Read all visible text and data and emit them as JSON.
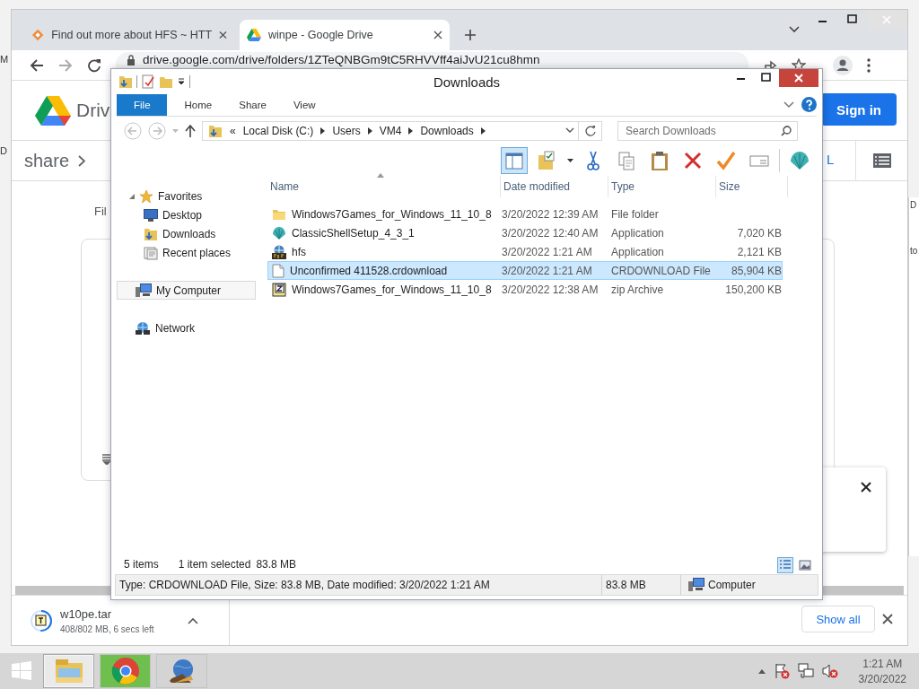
{
  "edge_fragments": {
    "left": [
      "M",
      "D"
    ],
    "right": [
      "D",
      "to"
    ]
  },
  "browser": {
    "tabs": [
      {
        "title": "Find out more about HFS ~ HTT",
        "kind": "hfs",
        "selected": false
      },
      {
        "title": "winpe - Google Drive",
        "kind": "drive",
        "selected": true
      }
    ],
    "address": "drive.google.com/drive/folders/1ZTeQNBGm9tC5RHVVff4aiJvU21cu8hmn",
    "page": {
      "brand": "Driv",
      "sign_in": "Sign in",
      "breadcrumb": "share",
      "link_fragment": "L",
      "column_fragment": "Fil"
    },
    "download": {
      "filename": "w10pe.tar",
      "progress": "408/802 MB, 6 secs left",
      "level": 0.51,
      "show_all": "Show all"
    }
  },
  "explorer": {
    "title": "Downloads",
    "ribbon_tabs": [
      {
        "label": "File",
        "selected": true
      },
      {
        "label": "Home",
        "selected": false
      },
      {
        "label": "Share",
        "selected": false
      },
      {
        "label": "View",
        "selected": false
      }
    ],
    "overflow": "«",
    "path": [
      "Local Disk (C:)",
      "Users",
      "VM4",
      "Downloads"
    ],
    "search": {
      "placeholder": "Search Downloads"
    },
    "toolbar": [
      {
        "kind": "preview-pane",
        "on": true
      },
      {
        "kind": "properties",
        "on": false
      },
      {
        "kind": "cut",
        "on": false
      },
      {
        "kind": "copy",
        "on": false
      },
      {
        "kind": "paste",
        "on": false
      },
      {
        "kind": "delete",
        "on": false
      },
      {
        "kind": "check",
        "on": false
      },
      {
        "kind": "rename",
        "on": false
      },
      {
        "kind": "shell",
        "on": false
      }
    ],
    "nav": [
      {
        "label": "Favorites",
        "kind": "favorites",
        "selected": false,
        "children": [
          {
            "label": "Desktop",
            "kind": "desktop",
            "selected": false
          },
          {
            "label": "Downloads",
            "kind": "downloads",
            "selected": false
          },
          {
            "label": "Recent places",
            "kind": "recent",
            "selected": false
          }
        ]
      },
      {
        "label": "My Computer",
        "kind": "computer",
        "selected": true
      },
      {
        "label": "Network",
        "kind": "network",
        "selected": false
      }
    ],
    "columns": [
      "Name",
      "Date modified",
      "Type",
      "Size"
    ],
    "files": [
      {
        "name": "Windows7Games_for_Windows_11_10_8",
        "date": "3/20/2022 12:39 AM",
        "type": "File folder",
        "kind": "folder",
        "selected": false
      },
      {
        "name": "ClassicShellSetup_4_3_1",
        "date": "3/20/2022 12:40 AM",
        "type": "Application",
        "size": "7,020 KB",
        "kind": "shell",
        "selected": false
      },
      {
        "name": "hfs",
        "date": "3/20/2022 1:21 AM",
        "type": "Application",
        "size": "2,121 KB",
        "kind": "hfs",
        "selected": false
      },
      {
        "name": "Unconfirmed 411528.crdownload",
        "date": "3/20/2022 1:21 AM",
        "type": "CRDOWNLOAD File",
        "size": "85,904 KB",
        "kind": "blank",
        "selected": true
      },
      {
        "name": "Windows7Games_for_Windows_11_10_8",
        "date": "3/20/2022 12:38 AM",
        "type": "zip Archive",
        "size": "150,200 KB",
        "kind": "zip",
        "selected": false
      }
    ],
    "status": {
      "count": "5 items",
      "selection": "1 item selected",
      "selection_size": "83.8 MB"
    },
    "views": [
      {
        "kind": "details",
        "selected": true
      },
      {
        "kind": "thumbnails",
        "selected": false
      }
    ],
    "details": {
      "summary": "Type: CRDOWNLOAD File, Size: 83.8 MB, Date modified: 3/20/2022 1:21 AM",
      "size": "83.8 MB",
      "zone": "Computer"
    }
  },
  "taskbar": {
    "apps": [
      {
        "kind": "explorer",
        "active": true
      },
      {
        "kind": "chrome",
        "active": false
      },
      {
        "kind": "globe",
        "active": false
      }
    ],
    "time": "1:21 AM",
    "date": "3/20/2022"
  }
}
